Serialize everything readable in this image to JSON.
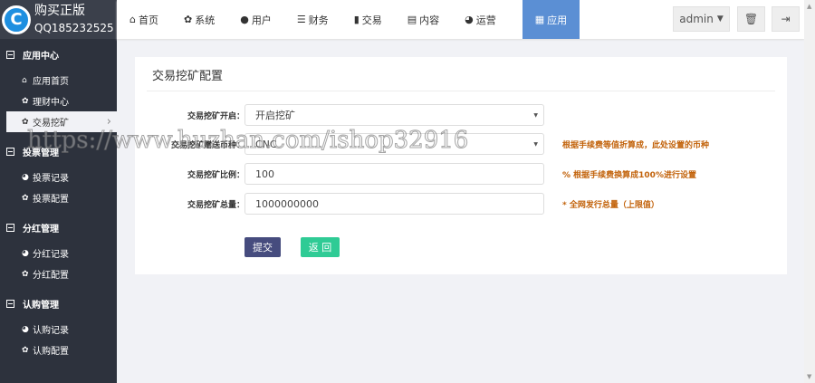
{
  "brand": {
    "title": "购买正版",
    "qq": "QQ185232525",
    "logo_letter": "C"
  },
  "sidebar": {
    "sections": [
      {
        "label": "应用中心",
        "items": [
          {
            "label": "应用首页",
            "icon": "home-icon"
          },
          {
            "label": "理财中心",
            "icon": "gear-icon"
          },
          {
            "label": "交易挖矿",
            "icon": "gear-icon",
            "active": true
          }
        ]
      },
      {
        "label": "投票管理",
        "items": [
          {
            "label": "投票记录",
            "icon": "globe-icon"
          },
          {
            "label": "投票配置",
            "icon": "gear-icon"
          }
        ]
      },
      {
        "label": "分红管理",
        "items": [
          {
            "label": "分红记录",
            "icon": "globe-icon"
          },
          {
            "label": "分红配置",
            "icon": "gear-icon"
          }
        ]
      },
      {
        "label": "认购管理",
        "items": [
          {
            "label": "认购记录",
            "icon": "globe-icon"
          },
          {
            "label": "认购配置",
            "icon": "gear-icon"
          }
        ]
      }
    ]
  },
  "topnav": [
    {
      "label": "首页",
      "icon": "home-icon"
    },
    {
      "label": "系统",
      "icon": "gear-icon"
    },
    {
      "label": "用户",
      "icon": "user-icon"
    },
    {
      "label": "财务",
      "icon": "list-icon"
    },
    {
      "label": "交易",
      "icon": "bar-chart-icon"
    },
    {
      "label": "内容",
      "icon": "document-icon"
    },
    {
      "label": "运营",
      "icon": "globe-icon"
    },
    {
      "label": "应用",
      "icon": "grid-icon",
      "active": true
    }
  ],
  "user": {
    "name": "admin"
  },
  "panel": {
    "title": "交易挖矿配置",
    "fields": [
      {
        "label": "交易挖矿开启：",
        "value": "开启挖矿",
        "type": "select",
        "hint": ""
      },
      {
        "label": "交易挖矿赠送币种：",
        "value": "CNC",
        "type": "select",
        "hint": "根据手续费等值折算成，此处设置的币种"
      },
      {
        "label": "交易挖矿比例：",
        "value": "100",
        "type": "input",
        "hint": "% 根据手续费换算成100%进行设置"
      },
      {
        "label": "交易挖矿总量：",
        "value": "1000000000",
        "type": "input",
        "hint": "* 全网发行总量（上限值）"
      }
    ],
    "submit": "提交",
    "back": "返 回"
  },
  "watermark": "https://www.huzhan.com/ishop32916",
  "colors": {
    "active_nav": "#5b8fd4",
    "submit": "#464c7e",
    "back": "#2fcb95",
    "hint": "#c2620a"
  }
}
